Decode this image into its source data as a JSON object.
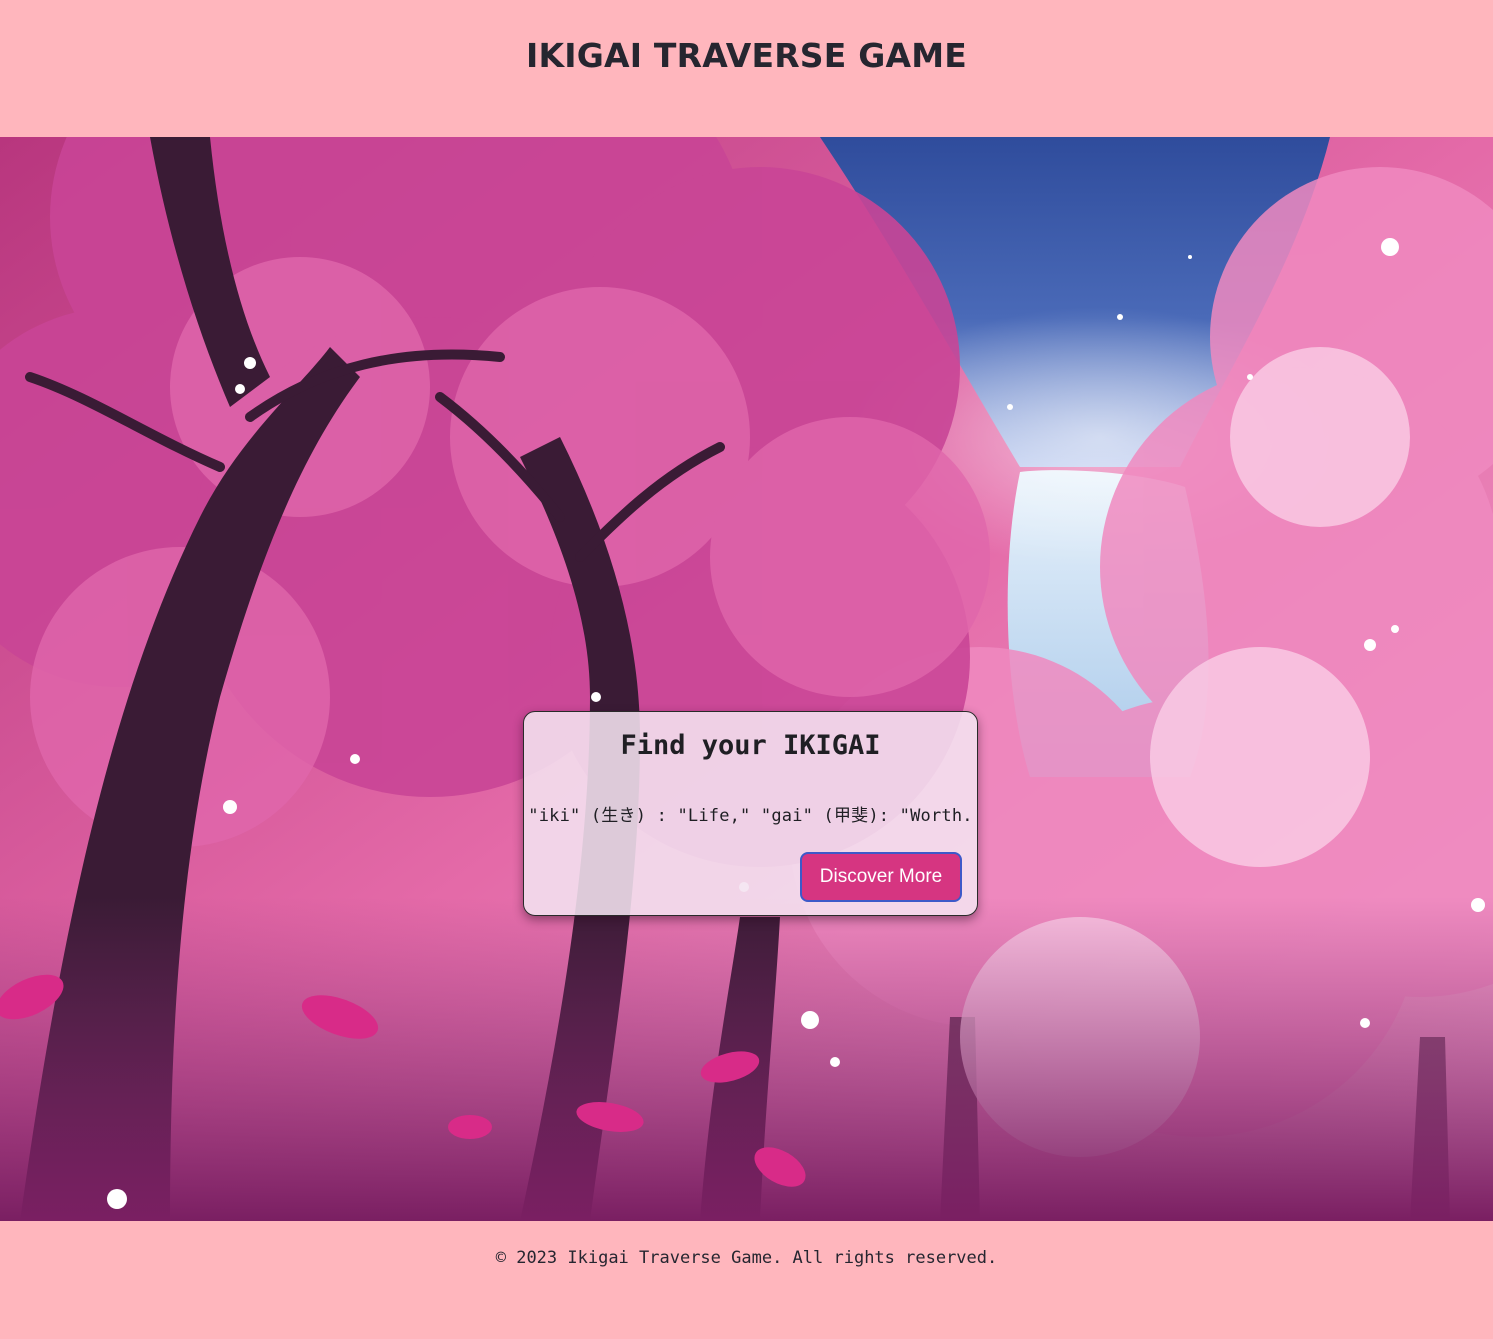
{
  "header": {
    "title": "IKIGAI TRAVERSE GAME"
  },
  "hero": {
    "background": "illustration of a pink cherry blossom forest with a waterfall under a starry sky",
    "colors": {
      "blossom": "#e0509a",
      "sky": "#3b5aa8",
      "trunk": "#3a1b35"
    }
  },
  "card": {
    "title": "Find your IKIGAI",
    "text": "\"iki\" (生き) : \"Life,\" \"gai\" (甲斐): \"Worth.",
    "button_label": "Discover More",
    "button_color": "#d63581"
  },
  "footer": {
    "copyright": "© 2023 Ikigai Traverse Game. All rights reserved."
  }
}
